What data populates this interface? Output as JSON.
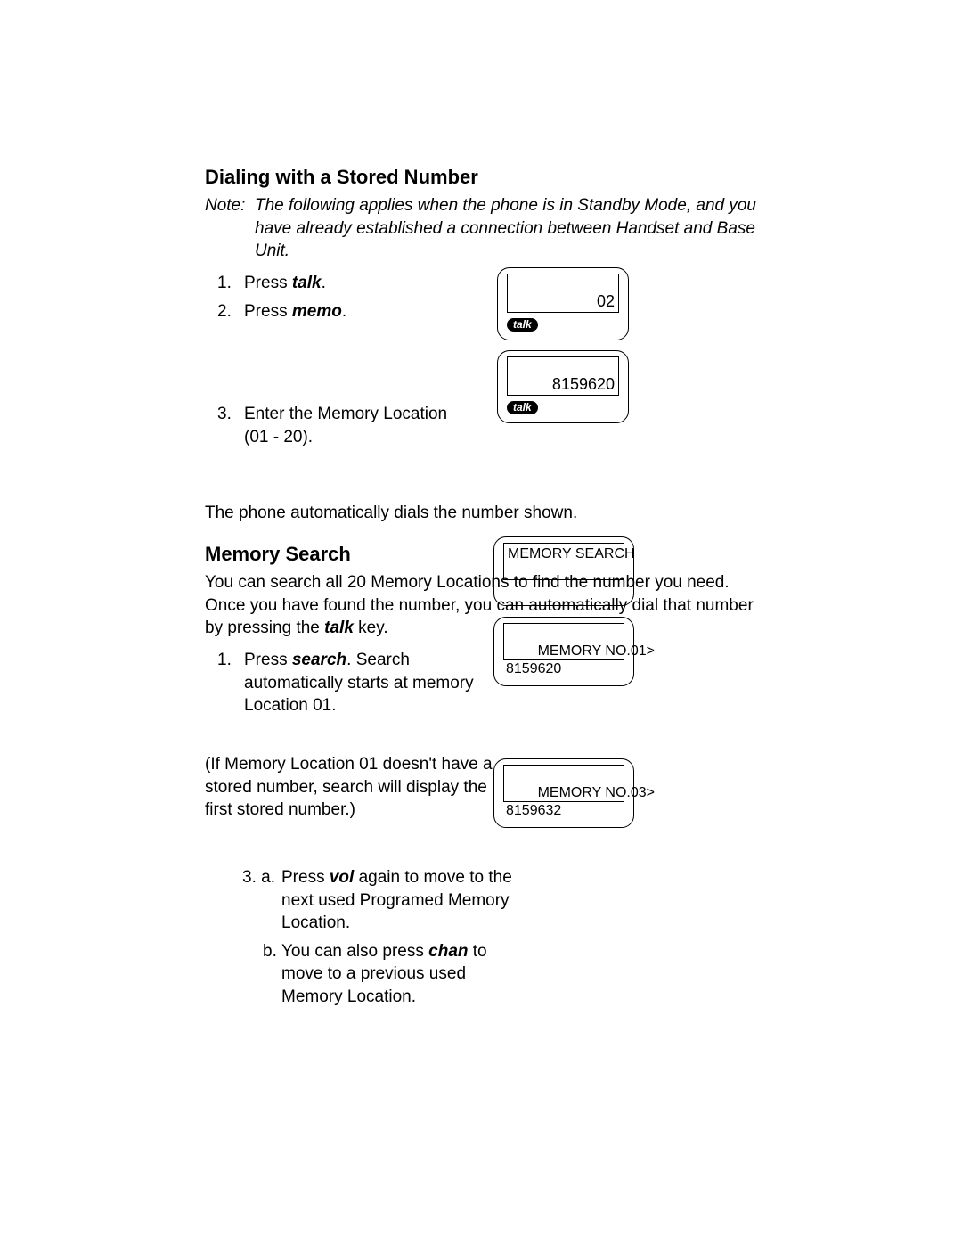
{
  "section1": {
    "heading": "Dialing with a Stored Number",
    "note_label": "Note:",
    "note_text": "The following applies when the phone is in Standby Mode, and you have already established a connection between Handset and Base Unit.",
    "step1_num": "1.",
    "step1_a": "Press ",
    "step1_b": "talk",
    "step1_c": ".",
    "step2_num": "2.",
    "step2_a": "Press ",
    "step2_b": "memo",
    "step2_c": ".",
    "step3_num": "3.",
    "step3_text": "Enter the Memory Location (01 - 20).",
    "result": "The phone automatically dials the number shown.",
    "display1_text": "02",
    "display1_pill": "talk",
    "display2_text": "8159620",
    "display2_pill": "talk"
  },
  "section2": {
    "heading": "Memory Search",
    "intro_a": "You can search all 20 Memory Locations to find the number you need. Once you have found the number, you can automatically dial that number by pressing the ",
    "intro_b": "talk",
    "intro_c": " key.",
    "step1_num": "1.",
    "step1_a": "Press ",
    "step1_b": "search",
    "step1_c": ". Search automatically starts at memory Location 01.",
    "display3_text": "MEMORY SEARCH",
    "para2": "(If Memory Location 01 doesn't have a stored number, search will display the first stored number.)",
    "display4_line1": "  MEMORY NO.01>",
    "display4_line2": "8159620",
    "step3a_label": "3. a.",
    "step3a_a": "Press ",
    "step3a_b": "vol",
    "step3a_c": " again to move to the next used Programed Memory Location.",
    "step3b_label": "b.",
    "step3b_a": "You can also press ",
    "step3b_b": "chan",
    "step3b_c": " to move to a previous used Memory Location.",
    "display5_line1": "  MEMORY NO.03>",
    "display5_line2": "8159632"
  }
}
